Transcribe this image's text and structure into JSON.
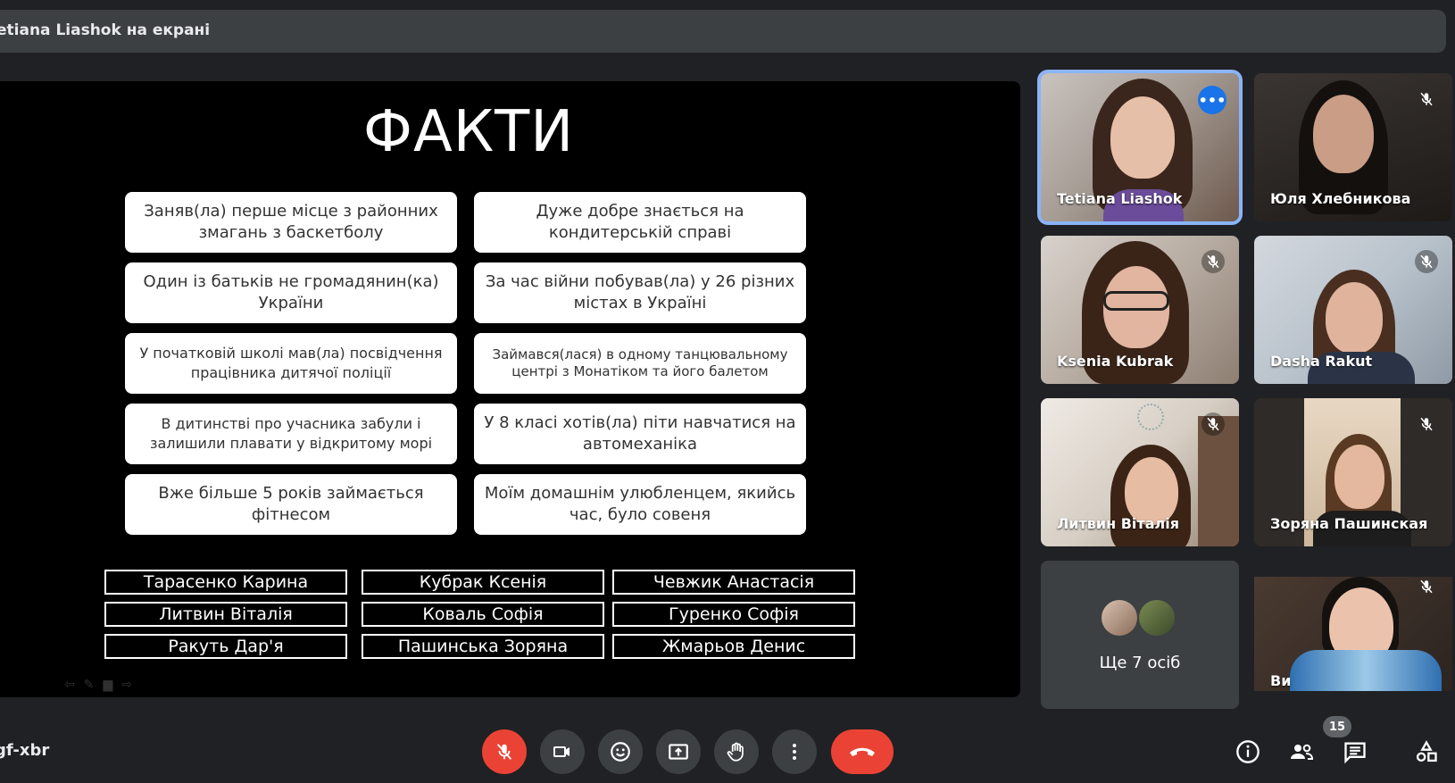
{
  "banner": {
    "presenting_text": "etiana Liashok на екрані"
  },
  "slide": {
    "title": "ФАКТИ",
    "facts": [
      "Заняв(ла) перше місце з районних змагань з баскетболу",
      "Дуже добре знається на кондитерській справі",
      "Один із батьків не громадянин(ка) України",
      "За час війни побував(ла) у 26 різних містах в Україні",
      "У початковій школі мав(ла) посвідчення працівника дитячої поліції",
      "Займався(лася) в одному танцювальному центрі з Монатіком та його балетом",
      "В дитинстві про учасника забули і залишили плавати у відкритому морі",
      "У 8 класі хотів(ла) піти навчатися на автомеханіка",
      "Вже більше 5 років займається фітнесом",
      "Моїм домашнім улюбленцем, якийсь час, було совеня"
    ],
    "names": [
      "Тарасенко Карина",
      "Кубрак Ксенія",
      "Чевжик Анастасія",
      "Литвин Віталія",
      "Коваль Софія",
      "Гуренко Софія",
      "Ракуть Дар'я",
      "Пашинська Зоряна",
      "Жмарьов Денис"
    ]
  },
  "participants": [
    {
      "name": "Tetiana Liashok",
      "active": true,
      "muted": false
    },
    {
      "name": "Юля Хлебникова",
      "muted": true
    },
    {
      "name": "Ksenia Kubrak",
      "muted": true
    },
    {
      "name": "Dasha Rakut",
      "muted": true
    },
    {
      "name": "Литвин Віталія",
      "muted": true
    },
    {
      "name": "Зоряна Пашинская",
      "muted": true
    },
    {
      "name": "Ви",
      "muted": true
    }
  ],
  "more_participants": {
    "label": "Ще 7 осіб"
  },
  "footer": {
    "meeting_code": "gf-xbr",
    "participant_count": "15",
    "controls": [
      "mic-off-icon",
      "camera-icon",
      "emoji-icon",
      "present-icon",
      "hand-raise-icon",
      "more-options-icon",
      "end-call-icon"
    ],
    "right_icons": [
      "info-icon",
      "people-icon",
      "chat-icon",
      "activities-icon"
    ]
  },
  "colors": {
    "background": "#202124",
    "accent": "#8ab4f8",
    "danger": "#ea4335",
    "tile": "#3c4043"
  }
}
